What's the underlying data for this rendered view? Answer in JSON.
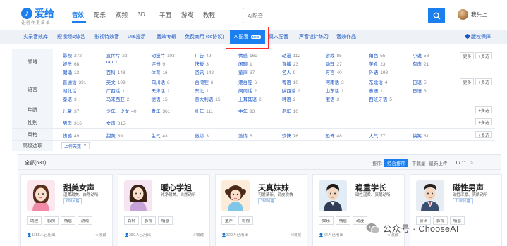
{
  "header": {
    "logo_text": "爱给",
    "logo_sub": "让 创 作 更 简 单",
    "nav": [
      "音效",
      "配乐",
      "视频",
      "3D",
      "平面",
      "游戏",
      "教程"
    ],
    "search_placeholder": "AI配音",
    "user_name": "我头上..."
  },
  "categories": [
    "实录音效库",
    "短视频&综艺",
    "影视特效音",
    "UI&提示",
    "音效专辑",
    "免费商用 (cc协议)",
    "AI配音",
    "真人配音",
    "声音设计练习",
    "音效作品"
  ],
  "ai_badge": "NEW",
  "copyright": "版权保障",
  "filters": {
    "domain": {
      "label": "领域",
      "options": [
        [
          "影视",
          "272"
        ],
        [
          "宣传片",
          "23"
        ],
        [
          "动漫片",
          "103"
        ],
        [
          "广告",
          "49"
        ],
        [
          "情感",
          "169"
        ],
        [
          "动漫",
          "112"
        ],
        [
          "游戏",
          "85"
        ],
        [
          "角色",
          "55"
        ],
        [
          "小说",
          "58"
        ],
        [
          "娱乐",
          "68"
        ],
        [
          "rap",
          "1"
        ],
        [
          "评书",
          "9"
        ],
        [
          "快板",
          "3"
        ],
        [
          "闲聊",
          "1"
        ],
        [
          "直播",
          "23"
        ],
        [
          "助理",
          "27"
        ],
        [
          "美食",
          "23"
        ],
        [
          "有声",
          "21"
        ],
        [
          "朗诵",
          "12"
        ],
        [
          "百科",
          "148"
        ],
        [
          "体育",
          "16"
        ],
        [
          "资讯",
          "142"
        ],
        [
          "童声",
          "37"
        ],
        [
          "名人",
          "9"
        ],
        [
          "方言",
          "40"
        ],
        [
          "外语",
          "198"
        ]
      ]
    },
    "language": {
      "label": "语言",
      "options": [
        [
          "普通话",
          "391"
        ],
        [
          "英文",
          "109"
        ],
        [
          "四川话",
          "6"
        ],
        [
          "台湾腔",
          "6"
        ],
        [
          "港台腔",
          "6"
        ],
        [
          "粤语",
          "10"
        ],
        [
          "河南话",
          "3"
        ],
        [
          "东北话",
          "4"
        ],
        [
          "日语",
          "5"
        ],
        [
          "湖北话",
          "1"
        ],
        [
          "广西话",
          "1"
        ],
        [
          "天津话",
          "2"
        ],
        [
          "东北",
          "1"
        ],
        [
          "闽南话",
          "2"
        ],
        [
          "陕西话",
          "2"
        ],
        [
          "山东话",
          "1"
        ],
        [
          "意语",
          "1"
        ],
        [
          "日语",
          "3"
        ],
        [
          "泰语",
          "3"
        ],
        [
          "马来西亚",
          "2"
        ],
        [
          "德语",
          "15"
        ],
        [
          "意大利语",
          "15"
        ],
        [
          "土耳其语",
          "2"
        ],
        [
          "韩语",
          "2"
        ],
        [
          "俄语",
          "3"
        ],
        [
          "西班牙语",
          "5"
        ]
      ]
    },
    "age": {
      "label": "年龄",
      "options": [
        [
          "儿童",
          "37"
        ],
        [
          "少年、少女",
          "40"
        ],
        [
          "青年",
          "361"
        ],
        [
          "壮年",
          "111"
        ],
        [
          "中年",
          "93"
        ],
        [
          "老年",
          "10"
        ]
      ]
    },
    "gender": {
      "label": "性别",
      "options": [
        [
          "男声",
          "316"
        ],
        [
          "女声",
          "315"
        ]
      ]
    },
    "style": {
      "label": "风格",
      "options": [
        [
          "伤感",
          "49"
        ],
        [
          "甜美",
          "89"
        ],
        [
          "生气",
          "43"
        ],
        [
          "傲娇",
          "3"
        ],
        [
          "激情",
          "6"
        ],
        [
          "欢快",
          "76"
        ],
        [
          "恐怖",
          "48"
        ],
        [
          "大气",
          "77"
        ],
        [
          "搞笑",
          "31"
        ]
      ]
    },
    "advanced": {
      "label": "高级选项",
      "select": "上传天数"
    },
    "more_label": "更多",
    "multi_label": "+多选"
  },
  "results": {
    "count": "全部(631)",
    "sort_label": "排序:",
    "sort_active": "综合排序",
    "sort_options": [
      "下载量",
      "最新上传"
    ],
    "pager": "1 / 11"
  },
  "cards": [
    {
      "name": "甜美女声",
      "desc": "温柔甜美、自然动听",
      "badge": "698风格",
      "tags": [
        "助理",
        "影视",
        "情感",
        "游戏"
      ],
      "stats": "1155人已用出",
      "fav": "收藏"
    },
    {
      "name": "暖心学姐",
      "desc": "纯净甜美、自然动听",
      "badge": "",
      "tags": [
        "百科",
        "影视",
        "情感"
      ],
      "stats": "380人已用出",
      "fav": "收藏"
    },
    {
      "name": "天真妹妹",
      "desc": "可爱清新、调皮欢快",
      "badge": "286风格",
      "tags": [
        "童声",
        "影视"
      ],
      "stats": "329人已用出",
      "fav": "收藏"
    },
    {
      "name": "稳重学长",
      "desc": "磁性温柔、爽朗动听",
      "badge": "",
      "tags": [
        "娱乐",
        "情感",
        "动漫"
      ],
      "stats": "64人已用出",
      "fav": "收藏"
    },
    {
      "name": "磁性男声",
      "desc": "磁性浑厚、爽朗动听",
      "badge": "1186风格",
      "tags": [
        "资讯",
        "影视",
        "情感"
      ],
      "stats": "",
      "fav": ""
    }
  ],
  "watermark": "公众号 · ChooseAI",
  "colors": {
    "brand": "#1b7ff0",
    "highlight": "#ff2b2b"
  }
}
